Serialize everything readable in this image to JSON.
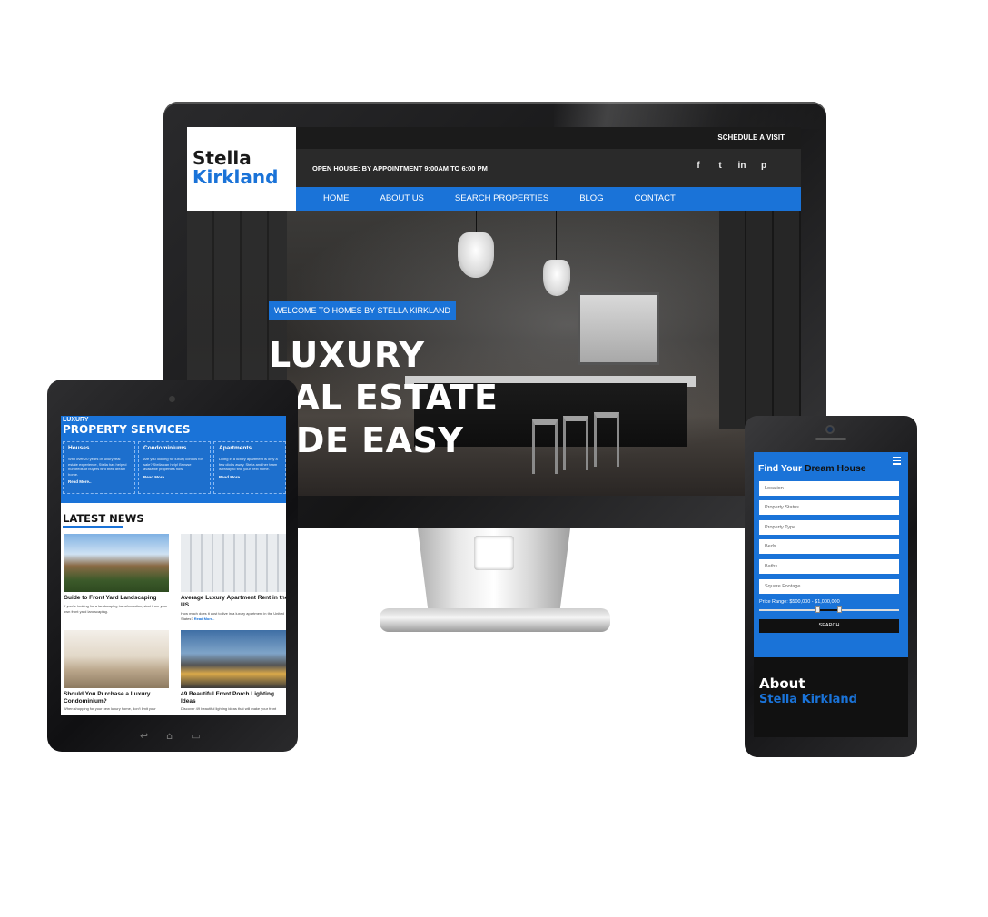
{
  "desktop": {
    "logo_line1": "Stella",
    "logo_line2": "Kirkland",
    "schedule_link": "SCHEDULE A VISIT",
    "open_house": "OPEN HOUSE: BY APPOINTMENT 9:00AM TO 6:00 PM",
    "social_icons": [
      "facebook-icon",
      "twitter-icon",
      "linkedin-icon",
      "pinterest-icon"
    ],
    "social_glyphs": [
      "f",
      "t",
      "in",
      "p"
    ],
    "nav": [
      "HOME",
      "ABOUT US",
      "SEARCH PROPERTIES",
      "BLOG",
      "CONTACT"
    ],
    "welcome_badge": "WELCOME TO HOMES BY STELLA KIRKLAND",
    "headline_1": "LUXURY",
    "headline_2": "EAL ESTATE",
    "headline_3": "ADE EASY"
  },
  "tablet": {
    "services_kicker": "LUXURY",
    "services_title": "PROPERTY SERVICES",
    "cards": [
      {
        "title": "Houses",
        "body": "With over 20 years of luxury real estate experience, Stella has helped hundreds of buyers find their dream home.",
        "more": "Read More.."
      },
      {
        "title": "Condominiums",
        "body": "Are you looking for luxury condos for sale? Stella can help! Browse available properties now.",
        "more": "Read More.."
      },
      {
        "title": "Apartments",
        "body": "Living in a luxury apartment is only a few clicks away. Stella and her team is ready to find your next home.",
        "more": "Read More.."
      }
    ],
    "news_title": "LATEST NEWS",
    "news": [
      {
        "title": "Guide to Front Yard Landscaping",
        "body": "If you're looking for a landscaping transformation, start from your own front yard landscaping.",
        "more": ""
      },
      {
        "title": "Average Luxury Apartment Rent in the US",
        "body": "How much does it cost to live in a luxury apartment in the United States?",
        "more": "Read More.."
      },
      {
        "title": "Should You Purchase a Luxury Condominium?",
        "body": "When shopping for your new luxury home, don't limit your",
        "more": ""
      },
      {
        "title": "49 Beautiful Front Porch Lighting Ideas",
        "body": "Discover 49 beautiful lighting ideas that will make your front",
        "more": ""
      }
    ]
  },
  "phone": {
    "find_prefix": "Find Your",
    "find_highlight": "Dream House",
    "fields": [
      "Location",
      "Property Status",
      "Property Type",
      "Beds",
      "Baths",
      "Square Footage"
    ],
    "price_range": "Price Range: $500,000 - $1,000,000",
    "price_min_fraction": 0.42,
    "price_max_fraction": 0.58,
    "search_button": "SEARCH",
    "about_line1": "About",
    "about_line2": "Stella Kirkland"
  },
  "colors": {
    "accent": "#1a73d8",
    "dark": "#1b1b1b"
  }
}
